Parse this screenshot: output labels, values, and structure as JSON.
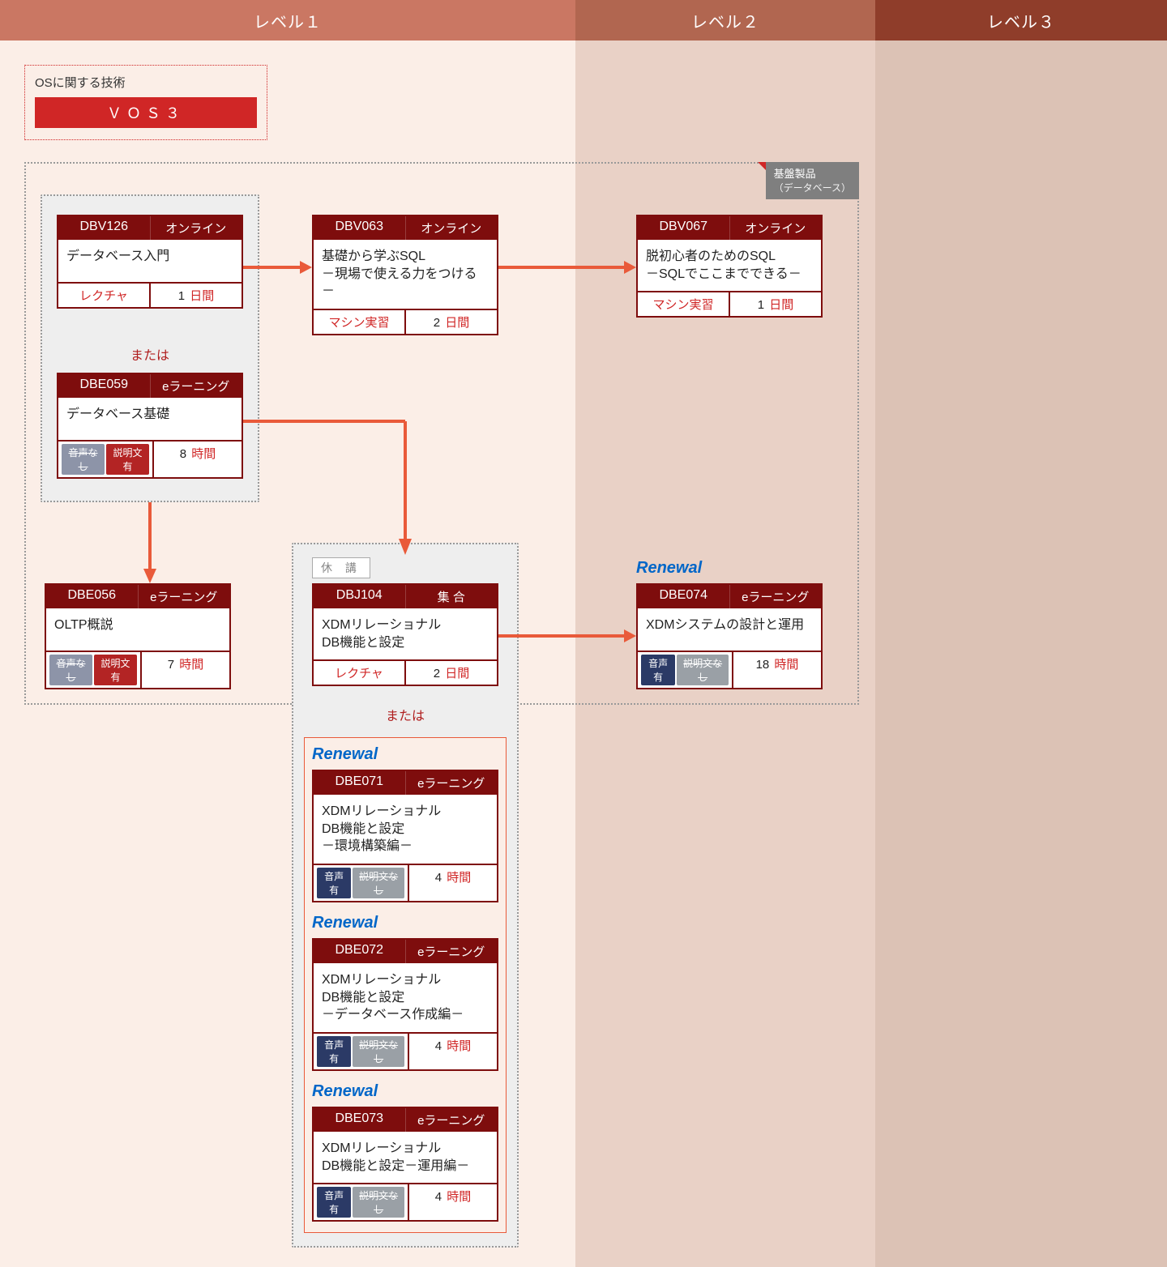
{
  "levels": {
    "l1": "レベル１",
    "l2": "レベル２",
    "l3": "レベル３"
  },
  "category": {
    "head": "OSに関する技術",
    "name": "ＶＯＳ３"
  },
  "region": {
    "title": "基盤製品",
    "sub": "（データベース）"
  },
  "labels": {
    "or": "または",
    "renewal": "Renewal",
    "kyuukou": "休 講"
  },
  "cards": {
    "dbv126": {
      "code": "DBV126",
      "type": "オンライン",
      "title": "データベース入門",
      "left_kind": "text",
      "left": "レクチャ",
      "dur_num": "1",
      "dur_unit": "日間"
    },
    "dbe059": {
      "code": "DBE059",
      "type": "eラーニング",
      "title": "データベース基礎",
      "left_kind": "pills",
      "pill1": "音声なし",
      "pill2": "説明文有",
      "pill_style": "noaudio",
      "dur_num": "8",
      "dur_unit": "時間"
    },
    "dbv063": {
      "code": "DBV063",
      "type": "オンライン",
      "title": "基礎から学ぶSQL\n－現場で使える力をつける－",
      "left_kind": "text",
      "left": "マシン実習",
      "dur_num": "2",
      "dur_unit": "日間"
    },
    "dbv067": {
      "code": "DBV067",
      "type": "オンライン",
      "title": "脱初心者のためのSQL\n－SQLでここまでできる－",
      "left_kind": "text",
      "left": "マシン実習",
      "dur_num": "1",
      "dur_unit": "日間"
    },
    "dbe056": {
      "code": "DBE056",
      "type": "eラーニング",
      "title": "OLTP概説",
      "left_kind": "pills",
      "pill1": "音声なし",
      "pill2": "説明文有",
      "pill_style": "noaudio",
      "dur_num": "7",
      "dur_unit": "時間"
    },
    "dbj104": {
      "code": "DBJ104",
      "type": "集 合",
      "title": "XDMリレーショナル\nDB機能と設定",
      "left_kind": "text",
      "left": "レクチャ",
      "dur_num": "2",
      "dur_unit": "日間"
    },
    "dbe074": {
      "code": "DBE074",
      "type": "eラーニング",
      "title": "XDMシステムの設計と運用",
      "left_kind": "pills",
      "pill1": "音声有",
      "pill2": "説明文なし",
      "pill_style": "audio",
      "dur_num": "18",
      "dur_unit": "時間"
    },
    "dbe071": {
      "code": "DBE071",
      "type": "eラーニング",
      "title": "XDMリレーショナル\nDB機能と設定\n－環境構築編－",
      "left_kind": "pills",
      "pill1": "音声有",
      "pill2": "説明文なし",
      "pill_style": "audio",
      "dur_num": "4",
      "dur_unit": "時間"
    },
    "dbe072": {
      "code": "DBE072",
      "type": "eラーニング",
      "title": "XDMリレーショナル\nDB機能と設定\n－データベース作成編－",
      "left_kind": "pills",
      "pill1": "音声有",
      "pill2": "説明文なし",
      "pill_style": "audio",
      "dur_num": "4",
      "dur_unit": "時間"
    },
    "dbe073": {
      "code": "DBE073",
      "type": "eラーニング",
      "title": "XDMリレーショナル\nDB機能と設定－運用編－",
      "left_kind": "pills",
      "pill1": "音声有",
      "pill2": "説明文なし",
      "pill_style": "audio",
      "dur_num": "4",
      "dur_unit": "時間"
    }
  }
}
